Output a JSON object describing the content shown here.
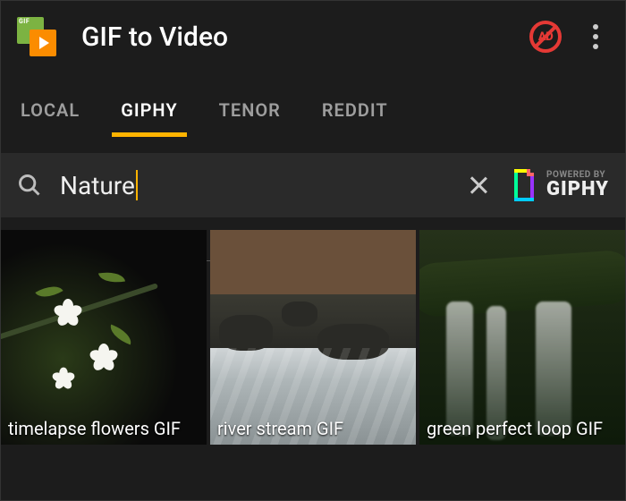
{
  "header": {
    "title": "GIF to Video",
    "app_icon_label": "GIF",
    "no_ads_label": "AD"
  },
  "tabs": [
    {
      "label": "LOCAL",
      "active": false
    },
    {
      "label": "GIPHY",
      "active": true
    },
    {
      "label": "TENOR",
      "active": false
    },
    {
      "label": "REDDIT",
      "active": false
    }
  ],
  "search": {
    "value": "Nature",
    "badge_small": "POWERED BY",
    "badge_big": "GIPHY"
  },
  "results": [
    {
      "caption": "timelapse flowers GIF"
    },
    {
      "caption": "river stream GIF"
    },
    {
      "caption": "green perfect loop GIF"
    }
  ]
}
